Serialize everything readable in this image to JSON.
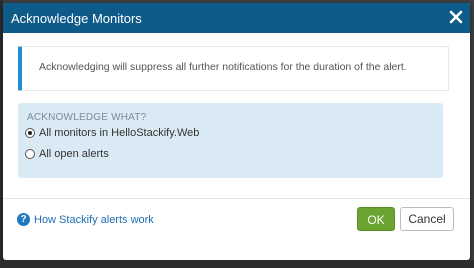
{
  "dialog": {
    "title": "Acknowledge Monitors",
    "close_icon": "close-x-icon"
  },
  "callout": {
    "text": "Acknowledging will suppress all further notifications for the duration of the alert."
  },
  "panel": {
    "heading": "ACKNOWLEDGE WHAT?",
    "options": [
      {
        "label": "All monitors in HelloStackify.Web",
        "checked": true
      },
      {
        "label": "All open alerts",
        "checked": false
      }
    ]
  },
  "footer": {
    "help_icon": "question-circle-icon",
    "help_link": "How Stackify alerts work",
    "ok_label": "OK",
    "cancel_label": "Cancel"
  },
  "colors": {
    "header": "#0e5b8a",
    "callout_accent": "#1f8dd6",
    "panel_bg": "#daeaf4",
    "ok_button": "#6aa431",
    "link": "#1f6fb5"
  }
}
